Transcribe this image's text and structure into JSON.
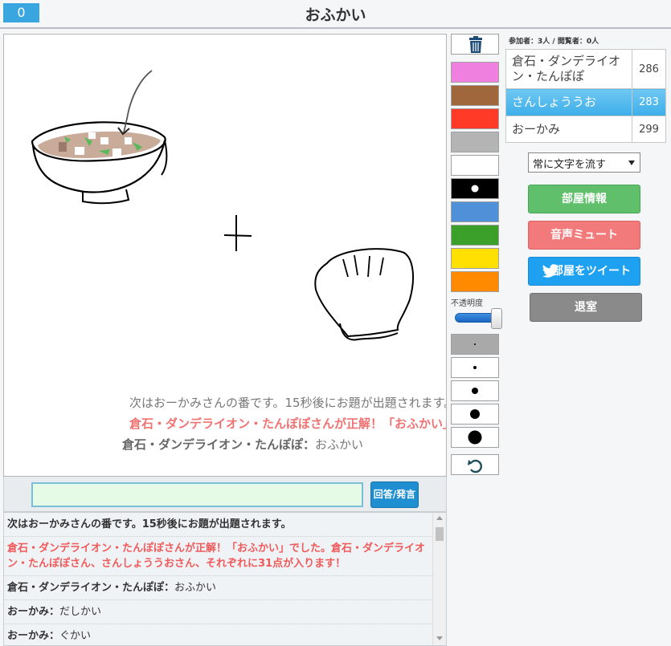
{
  "header": {
    "score": "0",
    "title": "おふかい"
  },
  "canvas": {
    "overlay": [
      {
        "text": "次はおーかみさんの番です。15秒後にお題が出題されます。"
      },
      {
        "text": "倉石・ダンデライオン・たんぽぽさんが正解！「おふかい」でした。"
      },
      {
        "speaker": "倉石・ダンデライオン・たんぽぽ",
        "sep": "：",
        "text": "おふかい"
      }
    ]
  },
  "answer": {
    "value": "",
    "button_label": "回答/発言"
  },
  "chat": [
    {
      "type": "notice",
      "text": "次はおーかみさんの番です。15秒後にお題が出題されます。"
    },
    {
      "type": "correct",
      "text": "倉石・ダンデライオン・たんぽぽさんが正解！「おふかい」でした。倉石・ダンデライオン・たんぽぽさん、さんしょううおさん、それぞれに31点が入ります！"
    },
    {
      "type": "message",
      "speaker": "倉石・ダンデライオン・たんぽぽ",
      "sep": "：",
      "text": "おふかい"
    },
    {
      "type": "message",
      "speaker": "おーかみ",
      "sep": "：",
      "text": "だしかい"
    },
    {
      "type": "message",
      "speaker": "おーかみ",
      "sep": "：",
      "text": "ぐかい"
    }
  ],
  "tools": {
    "trash_icon": "trash-icon",
    "colors": [
      "#f080e0",
      "#a0673c",
      "#ff3a26",
      "#b4b4b4",
      "#ffffff",
      "#000000",
      "#5090d8",
      "#3aa02a",
      "#ffe000",
      "#ff8a00"
    ],
    "selected_color_index": 5,
    "opacity_label": "不透明度",
    "opacity_value": 1.0,
    "brush_sizes": [
      "xs",
      "s",
      "m",
      "l",
      "xl"
    ],
    "selected_brush_index": 0,
    "undo_icon": "undo-icon"
  },
  "side": {
    "participants": "参加者：3人 / 閲覧者：0人",
    "players": [
      {
        "name": "倉石・ダンデライオン・たんぽぽ",
        "score": "286",
        "active": false
      },
      {
        "name": "さんしょううお",
        "score": "283",
        "active": true
      },
      {
        "name": "おーかみ",
        "score": "299",
        "active": false
      }
    ],
    "stream_mode": "常に文字を流す",
    "room_info_label": "部屋情報",
    "mute_label": "音声ミュート",
    "tweet_label": "部屋をツイート",
    "tweet_icon": "twitter-bird-icon",
    "leave_label": "退室"
  }
}
